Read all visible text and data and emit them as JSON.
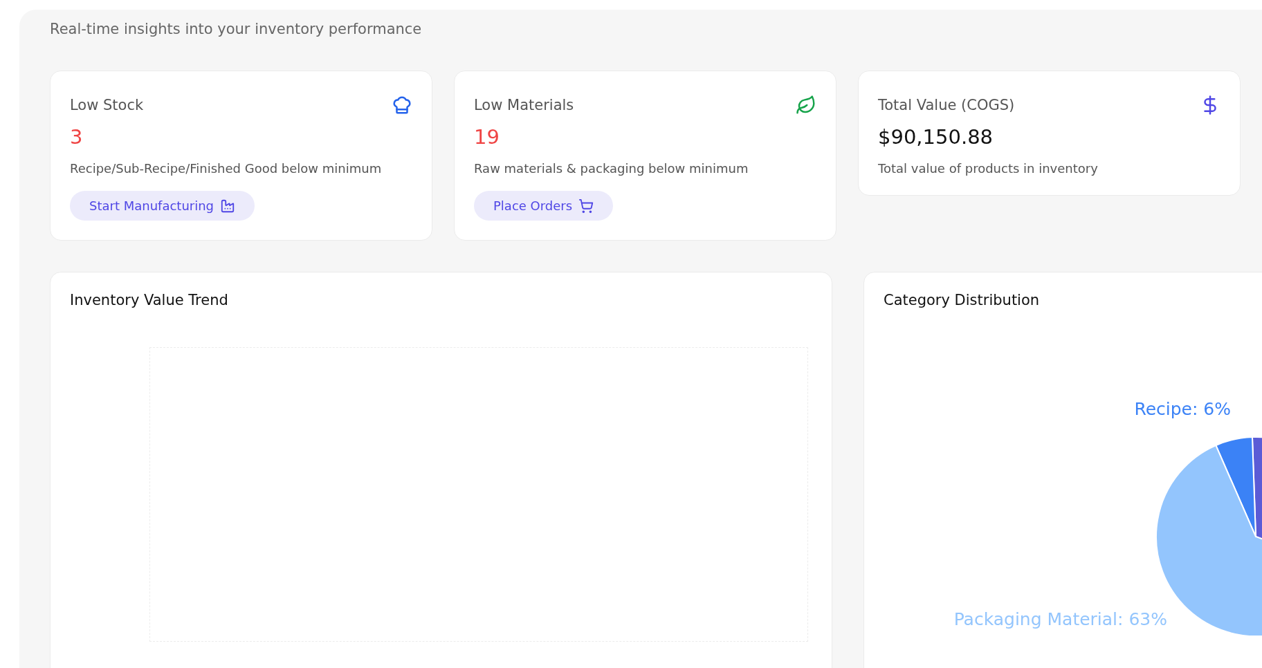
{
  "subtitle": "Real-time insights into your inventory performance",
  "stat_cards": [
    {
      "kind": "chef",
      "title": "Low Stock",
      "value": "3",
      "alert": true,
      "description": "Recipe/Sub-Recipe/Finished Good below minimum",
      "action": {
        "kind": "factory",
        "label": "Start Manufacturing"
      }
    },
    {
      "kind": "leaf",
      "title": "Low Materials",
      "value": "19",
      "alert": true,
      "description": "Raw materials & packaging below minimum",
      "action": {
        "kind": "cart",
        "label": "Place Orders"
      }
    },
    {
      "kind": "dollar",
      "title": "Total Value (COGS)",
      "value": "$90,150.88",
      "alert": false,
      "description": "Total value of products in inventory"
    }
  ],
  "trend_card": {
    "title": "Inventory Value Trend"
  },
  "distribution_card": {
    "title": "Category Distribution",
    "slice_labels": [
      {
        "text": "Recipe: 6%",
        "color": "#3b82f6"
      },
      {
        "text": "Packaging Material: 63%",
        "color": "#93c5fd"
      }
    ]
  }
}
